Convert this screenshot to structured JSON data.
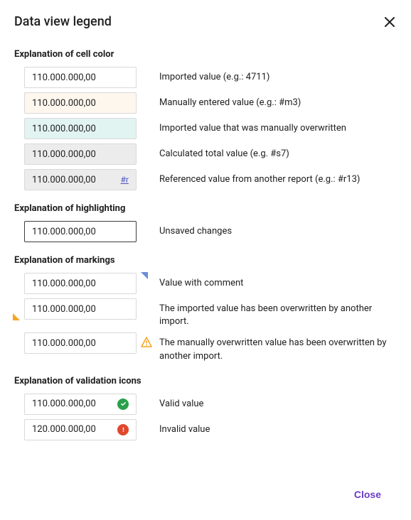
{
  "title": "Data view legend",
  "sections": {
    "cell_color": {
      "heading": "Explanation of cell color",
      "rows": [
        {
          "value": "110.000.000,00",
          "desc": "Imported value (e.g.: 4711)"
        },
        {
          "value": "110.000.000,00",
          "desc": "Manually entered value (e.g.: #m3)"
        },
        {
          "value": "110.000.000,00",
          "desc": "Imported value that was manually overwritten"
        },
        {
          "value": "110.000.000,00",
          "desc": "Calculated total value (e.g. #s7)"
        },
        {
          "value": "110.000.000,00",
          "ref": "#r",
          "desc": "Referenced value from another report (e.g.: #r13)"
        }
      ]
    },
    "highlighting": {
      "heading": "Explanation of highlighting",
      "rows": [
        {
          "value": "110.000.000,00",
          "desc": "Unsaved changes"
        }
      ]
    },
    "markings": {
      "heading": "Explanation of markings",
      "rows": [
        {
          "value": "110.000.000,00",
          "desc": "Value with comment"
        },
        {
          "value": "110.000.000,00",
          "desc": "The imported value has been overwritten by another import."
        },
        {
          "value": "110.000.000,00",
          "desc": "The manually overwritten value has been overwritten by another import."
        }
      ]
    },
    "validation": {
      "heading": "Explanation of validation icons",
      "rows": [
        {
          "value": "110.000.000,00",
          "desc": "Valid value"
        },
        {
          "value": "120.000.000,00",
          "desc": "Invalid value"
        }
      ]
    }
  },
  "footer": {
    "close": "Close"
  }
}
